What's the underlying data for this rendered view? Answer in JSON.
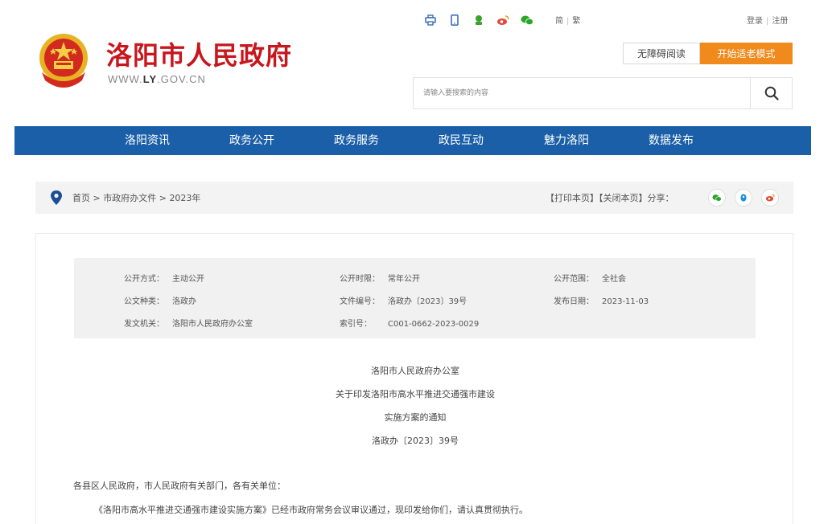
{
  "header": {
    "site_title": "洛阳市人民政府",
    "site_url_prefix": "WWW.",
    "site_url_bold": "LY",
    "site_url_suffix": ".GOV.CN",
    "lang_simplified": "简",
    "lang_sep": "|",
    "lang_traditional": "繁",
    "login": "登录",
    "auth_sep": "|",
    "register": "注册",
    "accessible_read": "无障碍阅读",
    "elder_mode": "开始适老模式",
    "search_placeholder": "请输入要搜索的内容",
    "top_icons": [
      "printer-icon",
      "mobile-icon",
      "weixin-public-icon",
      "weibo-icon",
      "wechat-icon"
    ]
  },
  "nav": {
    "items": [
      "洛阳资讯",
      "政务公开",
      "政务服务",
      "政民互动",
      "魅力洛阳",
      "数据发布"
    ]
  },
  "breadcrumb": {
    "home": "首页",
    "sep1": " > ",
    "level1": "市政府办文件",
    "sep2": " > ",
    "level2": "2023年",
    "print_page": "【打印本页】",
    "close_page": "【关闭本页】",
    "share_label": "分享：",
    "share_icons": [
      "wechat-share-icon",
      "qq-share-icon",
      "weibo-share-icon"
    ]
  },
  "meta": {
    "disclosure_method_label": "公开方式：",
    "disclosure_method": "主动公开",
    "disclosure_period_label": "公开时限：",
    "disclosure_period": "常年公开",
    "disclosure_scope_label": "公开范围：",
    "disclosure_scope": "全社会",
    "doc_type_label": "公文种类：",
    "doc_type": "洛政办",
    "doc_number_label": "文件编号：",
    "doc_number": "洛政办〔2023〕39号",
    "publish_date_label": "发布日期：",
    "publish_date": "2023-11-03",
    "issuer_label": "发文机关：",
    "issuer": "洛阳市人民政府办公室",
    "index_label": "索引号：",
    "index_number": "C001-0662-2023-0029"
  },
  "document": {
    "line1": "洛阳市人民政府办公室",
    "line2": "关于印发洛阳市高水平推进交通强市建设",
    "line3": "实施方案的通知",
    "line4": "洛政办〔2023〕39号",
    "salutation": "各县区人民政府，市人民政府有关部门，各有关单位：",
    "body1": "《洛阳市高水平推进交通强市建设实施方案》已经市政府常务会议审议通过，现印发给你们，请认真贯彻执行。"
  },
  "colors": {
    "brand_red": "#c8161d",
    "nav_blue": "#1a5fa8",
    "elder_orange": "#f08a1c"
  }
}
